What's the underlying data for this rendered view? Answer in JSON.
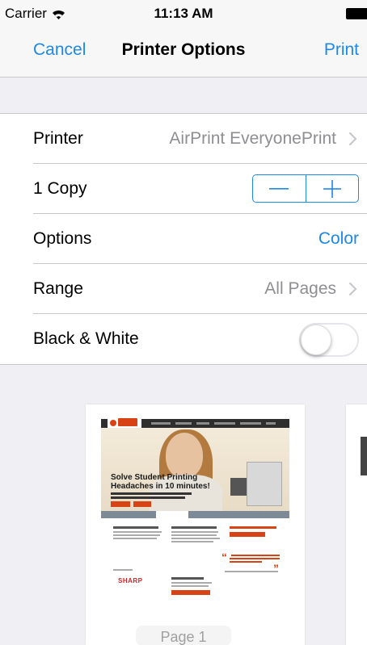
{
  "status_bar": {
    "carrier": "Carrier",
    "time": "11:13 AM"
  },
  "nav": {
    "cancel_label": "Cancel",
    "title": "Printer Options",
    "print_label": "Print"
  },
  "settings": {
    "printer": {
      "label": "Printer",
      "value": "AirPrint EveryonePrint"
    },
    "copies": {
      "label": "1 Copy"
    },
    "options": {
      "label": "Options",
      "value": "Color"
    },
    "range": {
      "label": "Range",
      "value": "All Pages"
    },
    "black_white": {
      "label": "Black & White",
      "enabled": false
    }
  },
  "preview": {
    "page_label": "Page 1",
    "hero_headline": "Solve Student Printing\nHeadaches in 10 minutes!",
    "partner_logo": "SHARP"
  },
  "colors": {
    "accent": "#1e88e5",
    "separator": "#c8c7cc",
    "background": "#efeff4"
  },
  "icons": {
    "wifi": "wifi-icon",
    "battery": "battery-icon",
    "chevron": "chevron-right-icon",
    "minus": "minus-icon",
    "plus": "plus-icon"
  }
}
